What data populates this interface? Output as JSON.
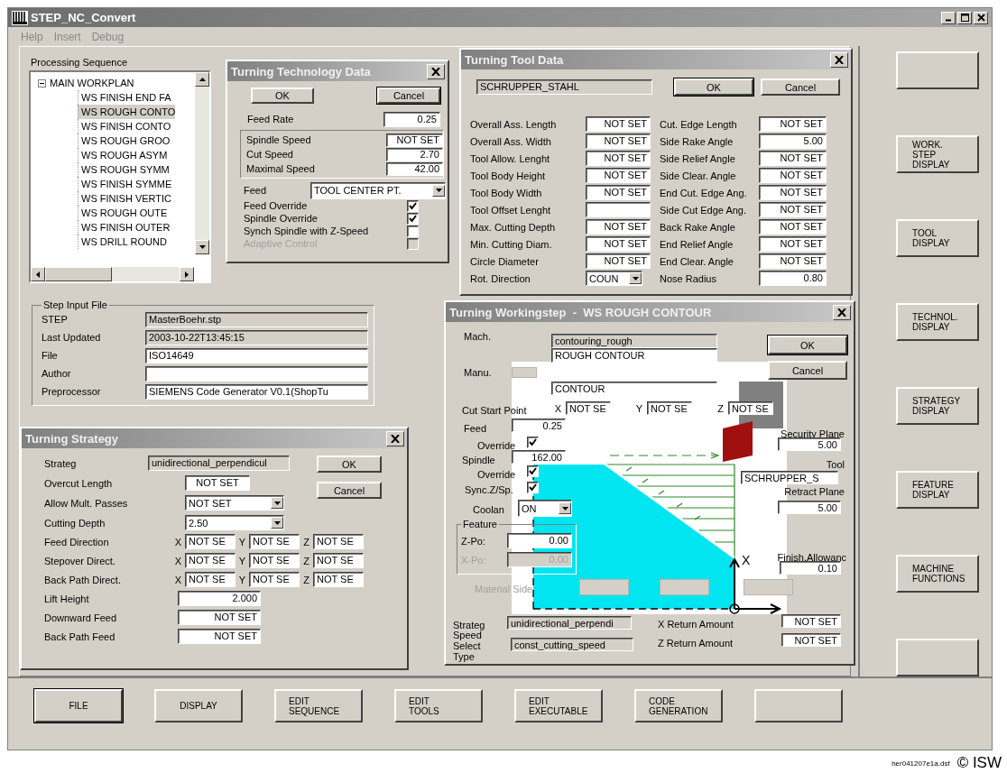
{
  "window": {
    "title": "STEP_NC_Convert"
  },
  "menu": [
    {
      "label": "Help"
    },
    {
      "label": "Insert"
    },
    {
      "label": "Debug"
    }
  ],
  "sequence": {
    "label": "Processing Sequence",
    "tree": [
      {
        "label": "MAIN WORKPLAN",
        "expanded": true,
        "selected": false,
        "children": [
          {
            "label": "WS FINISH END FA",
            "selected": false
          },
          {
            "label": "WS ROUGH CONTO",
            "selected": true
          },
          {
            "label": "WS FINISH CONTO",
            "selected": false
          },
          {
            "label": "WS ROUGH GROO",
            "selected": false
          },
          {
            "label": "WS ROUGH ASYM",
            "selected": false
          },
          {
            "label": "WS ROUGH SYMM",
            "selected": false
          },
          {
            "label": "WS FINISH SYMME",
            "selected": false
          },
          {
            "label": "WS FINISH VERTIC",
            "selected": false
          },
          {
            "label": "WS ROUGH OUTE",
            "selected": false
          },
          {
            "label": "WS FINISH OUTER",
            "selected": false
          },
          {
            "label": "WS DRILL ROUND",
            "selected": false
          }
        ]
      }
    ]
  },
  "technology": {
    "title": "Turning Technology Data",
    "ok": "OK",
    "cancel": "Cancel",
    "feed_rate": {
      "label": "Feed Rate",
      "value": "0.25"
    },
    "speeds": [
      {
        "label": "Spindle Speed",
        "value": "NOT SET"
      },
      {
        "label": "Cut Speed",
        "value": "2.70"
      },
      {
        "label": "Maximal Speed",
        "value": "42.00"
      }
    ],
    "feed": {
      "label": "Feed",
      "value": "TOOL CENTER PT."
    },
    "options": [
      {
        "label": "Feed Override",
        "checked": true,
        "disabled": false
      },
      {
        "label": "Spindle Override",
        "checked": true,
        "disabled": false
      },
      {
        "label": "Synch Spindle with Z-Speed",
        "checked": false,
        "disabled": false
      },
      {
        "label": "Adaptive Control",
        "checked": false,
        "disabled": true
      }
    ]
  },
  "tool": {
    "title": "Turning Tool Data",
    "name": "SCHRUPPER_STAHL",
    "ok": "OK",
    "cancel": "Cancel",
    "left": [
      {
        "label": "Overall Ass. Length",
        "value": "NOT SET",
        "kind": "field"
      },
      {
        "label": "Overall Ass. Width",
        "value": "NOT SET",
        "kind": "field"
      },
      {
        "label": "Tool Allow. Lenght",
        "value": "NOT SET",
        "kind": "field"
      },
      {
        "label": "Tool Body Height",
        "value": "NOT SET",
        "kind": "field"
      },
      {
        "label": "Tool Body Width",
        "value": "NOT SET",
        "kind": "field"
      },
      {
        "label": "Tool Offset Lenght",
        "kind": "field"
      },
      {
        "label": "Max. Cutting Depth",
        "value": "NOT SET",
        "kind": "field"
      },
      {
        "label": "Min. Cutting Diam.",
        "value": "NOT SET",
        "kind": "field"
      },
      {
        "label": "Circle Diameter",
        "value": "NOT SET",
        "kind": "field"
      },
      {
        "label": "Rot. Direction",
        "value": "COUN",
        "kind": "dropdown"
      }
    ],
    "right": [
      {
        "label": "Cut. Edge Length",
        "value": "NOT SET"
      },
      {
        "label": "Side Rake Angle",
        "value": "5.00"
      },
      {
        "label": "Side Relief Angle",
        "value": "NOT SET"
      },
      {
        "label": "Side Clear. Angle",
        "value": "NOT SET"
      },
      {
        "label": "End Cut. Edge Ang.",
        "value": "NOT SET"
      },
      {
        "label": "Side Cut Edge Ang.",
        "value": "NOT SET"
      },
      {
        "label": "Back Rake Angle",
        "value": "NOT SET"
      },
      {
        "label": "End Relief Angle",
        "value": "NOT SET"
      },
      {
        "label": "End Clear. Angle",
        "value": "NOT SET"
      },
      {
        "label": "Nose Radius",
        "value": "0.80"
      }
    ]
  },
  "step_input_file": {
    "title": "Step Input File",
    "rows": [
      {
        "label": "STEP",
        "value": "MasterBoehr.stp",
        "editable": false
      },
      {
        "label": "Last Updated",
        "value": "2003-10-22T13:45:15",
        "editable": false
      },
      {
        "label": "File",
        "value": "ISO14649",
        "editable": true
      },
      {
        "label": "Author",
        "editable": true
      },
      {
        "label": "Preprocessor",
        "value": "SIEMENS Code Generator V0.1(ShopTu",
        "editable": true
      }
    ]
  },
  "strategy": {
    "title": "Turning Strategy",
    "strategy": {
      "label": "Strateg",
      "value": "unidirectional_perpendicul"
    },
    "ok": "OK",
    "cancel": "Cancel",
    "settings": [
      {
        "label": "Overcut Length",
        "value": "NOT SET",
        "kind": "field"
      },
      {
        "label": "Allow Mult. Passes",
        "value": "NOT SET",
        "kind": "dropdown"
      },
      {
        "label": "Cutting Depth",
        "value": "2.50",
        "kind": "dropdown"
      }
    ],
    "directions": [
      {
        "label": "Feed Direction",
        "axes": [
          {
            "axis": "X",
            "value": "NOT SE"
          },
          {
            "axis": "Y",
            "value": "NOT SE"
          },
          {
            "axis": "Z",
            "value": "NOT SE"
          }
        ]
      },
      {
        "label": "Stepover Direct.",
        "axes": [
          {
            "axis": "X",
            "value": "NOT SE"
          },
          {
            "axis": "Y",
            "value": "NOT SE"
          },
          {
            "axis": "Z",
            "value": "NOT SE"
          }
        ]
      },
      {
        "label": "Back Path Direct.",
        "axes": [
          {
            "axis": "X",
            "value": "NOT SE"
          },
          {
            "axis": "Y",
            "value": "NOT SE"
          },
          {
            "axis": "Z",
            "value": "NOT SE"
          }
        ]
      }
    ],
    "feeds": [
      {
        "label": "Lift Height",
        "value": "2.000"
      },
      {
        "label": "Downward Feed",
        "value": "NOT SET"
      },
      {
        "label": "Back Path Feed",
        "value": "NOT SET"
      }
    ]
  },
  "workingstep": {
    "title": "Turning Workingstep  -  WS ROUGH CONTOUR",
    "ok": "OK",
    "cancel": "Cancel",
    "mach_label": "Mach.",
    "mach_values": [
      "contouring_rough",
      "ROUGH CONTOUR"
    ],
    "manu_label": "Manu.",
    "contour": "CONTOUR",
    "cut_start": {
      "label": "Cut Start Point",
      "axes": [
        {
          "axis": "X",
          "value": "NOT SE"
        },
        {
          "axis": "Y",
          "value": "NOT SE"
        },
        {
          "axis": "Z",
          "value": "NOT SE"
        }
      ]
    },
    "feed": {
      "label": "Feed",
      "value": "0.25"
    },
    "feed_override": {
      "label": "Override",
      "checked": true
    },
    "spindle": {
      "label": "Spindle",
      "value": "162.00"
    },
    "spindle_override": {
      "label": "Override",
      "checked": true
    },
    "sync": {
      "label": "Sync.Z/Sp.",
      "checked": true
    },
    "coolant": {
      "label": "Coolan",
      "value": "ON"
    },
    "feature": {
      "title": "Feature",
      "z": {
        "label": "Z-Po:",
        "value": "0.00",
        "disabled": false
      },
      "x": {
        "label": "X-Po:",
        "value": "0.00",
        "disabled": true
      }
    },
    "material_side": {
      "label": "Material Side",
      "disabled": true
    },
    "security_plane": {
      "label": "Security Plane",
      "value": "5.00"
    },
    "tool": {
      "label": "Tool",
      "value": "SCHRUPPER_S"
    },
    "retract_plane": {
      "label": "Retract Plane",
      "value": "5.00"
    },
    "finish_allowance": {
      "label": "Finish.Allowanc",
      "value": "0.10"
    },
    "axis_label": "X",
    "strategy": {
      "label": "Strateg",
      "value": "unidirectional_perpendi"
    },
    "speed_select": {
      "label": "Speed Select Type",
      "value": "const_cutting_speed"
    },
    "x_return": {
      "label": "X Return Amount",
      "value": "NOT SET"
    },
    "z_return": {
      "label": "Z Return Amount",
      "value": "NOT SET"
    }
  },
  "side_buttons": [
    {
      "kind": "blank"
    },
    {
      "kind": "labeled",
      "lines": [
        "WORK.",
        "STEP",
        "DISPLAY"
      ]
    },
    {
      "kind": "labeled",
      "lines": [
        "TOOL",
        "DISPLAY"
      ]
    },
    {
      "kind": "labeled",
      "lines": [
        "TECHNOL.",
        "DISPLAY"
      ]
    },
    {
      "kind": "labeled",
      "lines": [
        "STRATEGY",
        "DISPLAY"
      ]
    },
    {
      "kind": "labeled",
      "lines": [
        "FEATURE",
        "DISPLAY"
      ]
    },
    {
      "kind": "labeled",
      "lines": [
        "MACHINE",
        "FUNCTIONS"
      ]
    },
    {
      "kind": "blank"
    }
  ],
  "bottom_buttons": [
    {
      "kind": "labeled",
      "lines": [
        "FILE"
      ],
      "selected": true
    },
    {
      "kind": "labeled",
      "lines": [
        "DISPLAY"
      ],
      "selected": false
    },
    {
      "kind": "labeled",
      "lines": [
        "EDIT",
        "SEQUENCE"
      ],
      "selected": false
    },
    {
      "kind": "labeled",
      "lines": [
        "EDIT",
        "TOOLS"
      ],
      "selected": false
    },
    {
      "kind": "labeled",
      "lines": [
        "EDIT",
        "EXECUTABLE"
      ],
      "selected": false
    },
    {
      "kind": "labeled",
      "lines": [
        "CODE",
        "GENERATION"
      ],
      "selected": false
    },
    {
      "kind": "blank",
      "selected": false
    }
  ],
  "caption": {
    "file": "her041207e1a.dsf",
    "copyright": "© ISW"
  }
}
